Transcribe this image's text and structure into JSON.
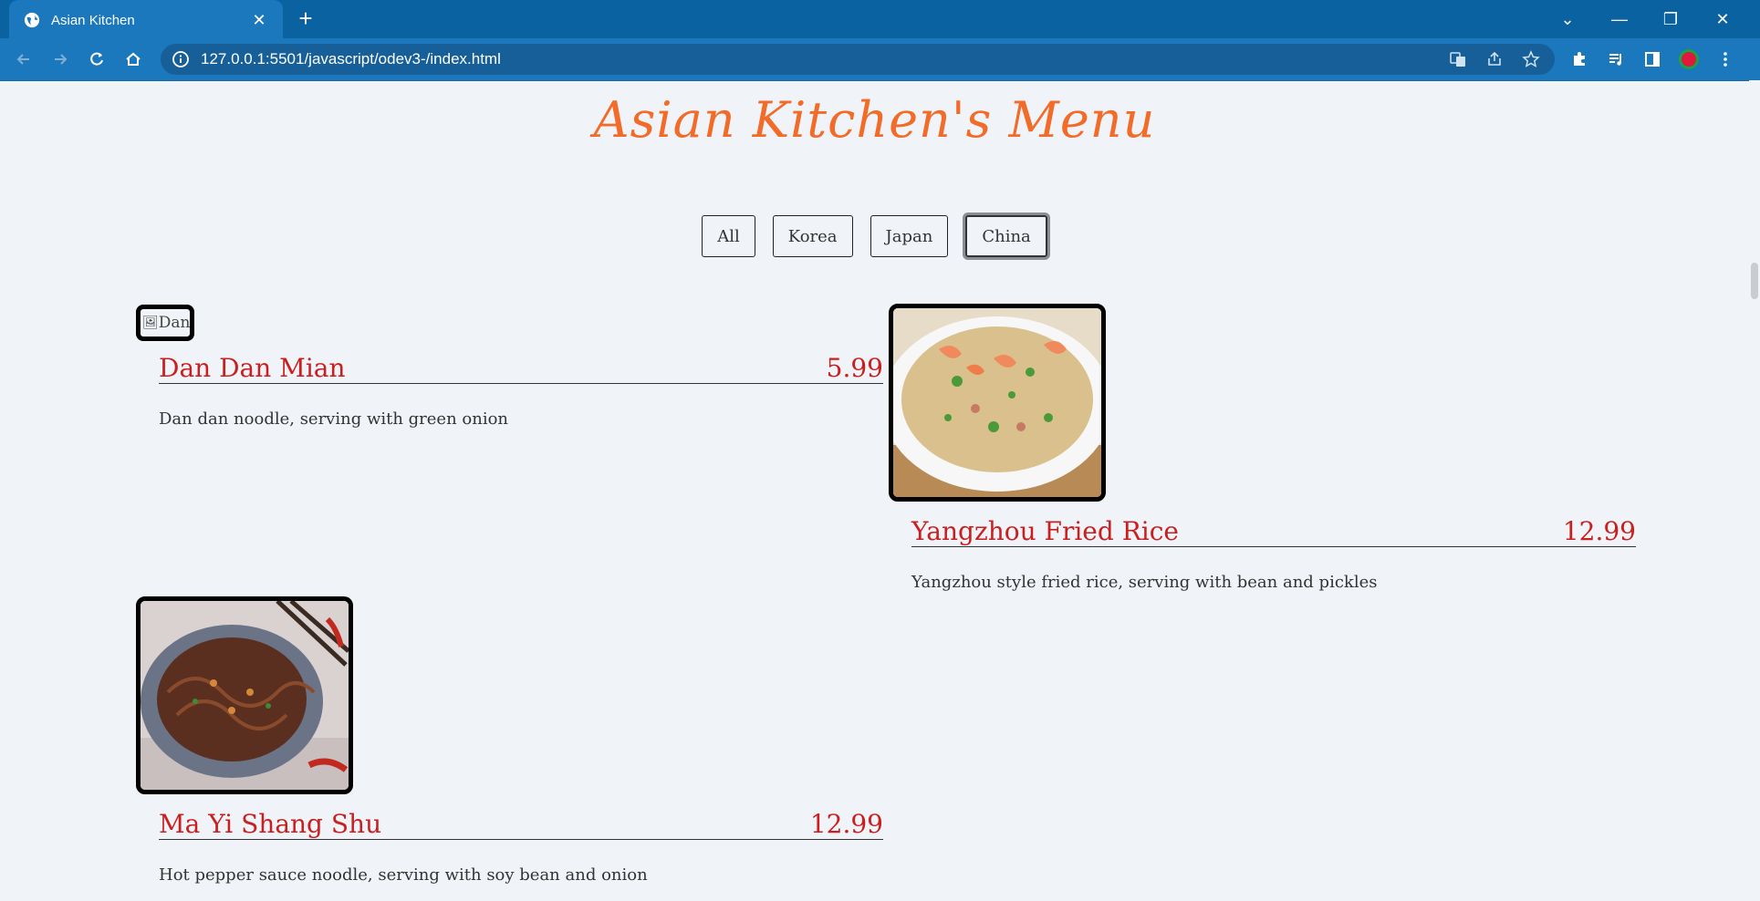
{
  "browser": {
    "tab_title": "Asian Kitchen",
    "url": "127.0.0.1:5501/javascript/odev3-/index.html"
  },
  "page": {
    "title": "Asian Kitchen's Menu",
    "filters": [
      "All",
      "Korea",
      "Japan",
      "China"
    ],
    "active_filter": "China"
  },
  "menu": [
    {
      "name": "Dan Dan Mian",
      "price": "5.99",
      "desc": "Dan dan noodle, serving with green onion",
      "img_alt": "Dan",
      "img_loaded": false
    },
    {
      "name": "Yangzhou Fried Rice",
      "price": "12.99",
      "desc": "Yangzhou style fried rice, serving with bean and pickles",
      "img_loaded": true
    },
    {
      "name": "Ma Yi Shang Shu",
      "price": "12.99",
      "desc": "Hot pepper sauce noodle, serving with soy bean and onion",
      "img_loaded": true
    }
  ],
  "colors": {
    "accent": "#f26b28",
    "item_title": "#c91f1f",
    "chrome": "#0b62a1"
  }
}
